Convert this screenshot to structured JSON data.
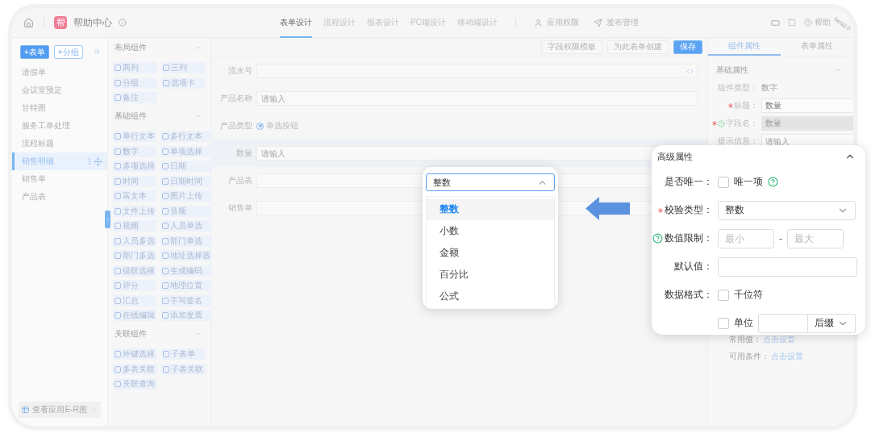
{
  "topbar": {
    "app_icon": "帮",
    "app_name": "帮助中心",
    "badge": "beta2.0",
    "help": "帮助",
    "tabs": [
      {
        "label": "表单设计",
        "selected": true
      },
      {
        "label": "流程设计",
        "selected": false
      },
      {
        "label": "报表设计",
        "selected": false
      },
      {
        "label": "PC端设计",
        "selected": false
      },
      {
        "label": "移动端设计",
        "selected": false
      }
    ],
    "actions": [
      {
        "kind": "user",
        "label": "应用权限"
      },
      {
        "kind": "send",
        "label": "发布管理"
      }
    ]
  },
  "sidebar": {
    "buttons": [
      {
        "label": "+表单",
        "primary": true
      },
      {
        "label": "+分组",
        "primary": false
      }
    ],
    "items": [
      {
        "label": "请假单",
        "selected": false
      },
      {
        "label": "会议室预定",
        "selected": false
      },
      {
        "label": "甘特图",
        "selected": false
      },
      {
        "label": "服务工单处理",
        "selected": false
      },
      {
        "label": "流程标题",
        "selected": false
      },
      {
        "label": "销售明细",
        "selected": true
      },
      {
        "label": "销售单",
        "selected": false
      },
      {
        "label": "产品表",
        "selected": false
      }
    ],
    "footer": "查看应用E-R图"
  },
  "palette": [
    {
      "title": "布局组件",
      "expanded": true,
      "items": [
        "两列",
        "三列",
        "分组",
        "选项卡",
        "备注"
      ]
    },
    {
      "title": "基础组件",
      "expanded": true,
      "items": [
        "单行文本",
        "多行文本",
        "数字",
        "单项选择",
        "多项选择",
        "日期",
        "时间",
        "日期时间",
        "富文本",
        "图片上传",
        "文件上传",
        "音频",
        "视频",
        "人员单选",
        "人员多选",
        "部门单选",
        "部门多选",
        "地址选择器",
        "级联选择",
        "生成编码",
        "评分",
        "地理位置",
        "汇总",
        "手写签名",
        "在线编辑",
        "添加发票"
      ]
    },
    {
      "title": "关联组件",
      "expanded": true,
      "items": [
        "外键选择",
        "子表单",
        "多表关联",
        "子表关联",
        "关联查询"
      ]
    }
  ],
  "canvas": {
    "buttons": [
      {
        "label": "字段权限模板",
        "primary": false
      },
      {
        "label": "为此表单创建",
        "primary": false
      },
      {
        "label": "保存",
        "primary": true
      }
    ],
    "fields": [
      {
        "kind": "serial",
        "label": "流水号",
        "selected": false
      },
      {
        "kind": "input",
        "label": "产品名称",
        "placeholder": "请输入",
        "selected": false
      },
      {
        "kind": "radio",
        "label": "产品类型",
        "option": "单选按钮",
        "checked": true,
        "selected": false
      },
      {
        "kind": "input",
        "label": "数量",
        "placeholder": "请输入",
        "selected": true
      },
      {
        "kind": "input",
        "label": "产品表",
        "selected": false
      },
      {
        "kind": "input",
        "label": "销售单",
        "selected": false
      }
    ]
  },
  "properties": {
    "tabs": [
      {
        "label": "组件属性",
        "selected": true
      },
      {
        "label": "表单属性",
        "selected": false
      }
    ],
    "section": {
      "title": "基础属性",
      "expanded": true
    },
    "rows": [
      {
        "kind": "text",
        "label": "组件类型：",
        "value": "数字",
        "required": false,
        "help": false
      },
      {
        "kind": "input",
        "label": "标题：",
        "value": "数量",
        "required": true,
        "help": false,
        "disabled": false
      },
      {
        "kind": "input",
        "label": "字段名：",
        "value": "数量",
        "required": true,
        "help": true,
        "disabled": true
      },
      {
        "kind": "input",
        "label": "提示信息：",
        "placeholder": "请输入",
        "required": false,
        "help": false,
        "disabled": false
      }
    ],
    "links": [
      {
        "label": "常用值：",
        "link": "点击设置"
      },
      {
        "label": "可用条件：",
        "link": "点击设置"
      }
    ]
  },
  "type_dropdown": {
    "value": "整数",
    "expanded": true,
    "options": [
      {
        "label": "整数",
        "selected": true
      },
      {
        "label": "小数",
        "selected": false
      },
      {
        "label": "金额",
        "selected": false
      },
      {
        "label": "百分比",
        "selected": false
      },
      {
        "label": "公式",
        "selected": false
      }
    ]
  },
  "advanced": {
    "title": "高级属性",
    "expanded": true,
    "rows": [
      {
        "kind": "checkbox",
        "label": "是否唯一：",
        "option": "唯一项",
        "checked": false,
        "required": false,
        "help": false,
        "option_help": true
      },
      {
        "kind": "select",
        "label": "校验类型：",
        "value": "整数",
        "required": true,
        "help": false
      },
      {
        "kind": "range",
        "label": "数值限制：",
        "min_placeholder": "最小",
        "separator": "-",
        "max_placeholder": "最大",
        "required": false,
        "help": true
      },
      {
        "kind": "input",
        "label": "默认值：",
        "required": false,
        "help": false
      },
      {
        "kind": "checkbox",
        "label": "数据格式：",
        "option": "千位符",
        "checked": false,
        "required": false,
        "help": false,
        "option_help": false
      },
      {
        "kind": "unit",
        "option": "单位",
        "checked": false,
        "suffix": "后缀",
        "required": false,
        "help": false
      }
    ]
  }
}
